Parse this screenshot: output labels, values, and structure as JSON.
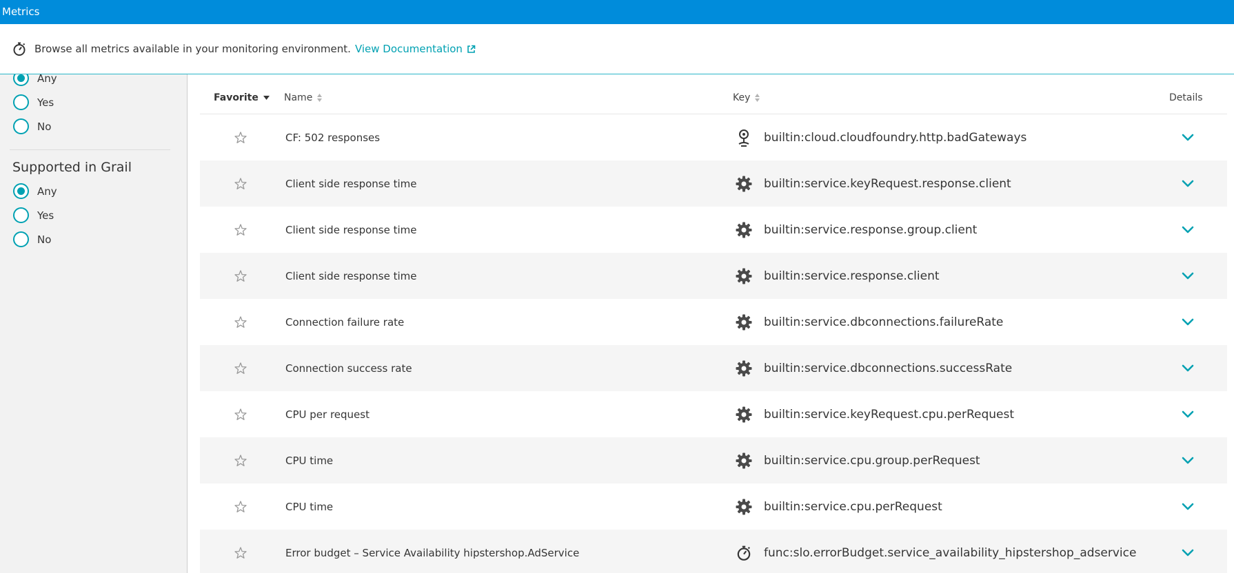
{
  "topbar": {
    "title": "Metrics"
  },
  "info": {
    "text": "Browse all metrics available in your monitoring environment.",
    "link": "View Documentation",
    "icon": "stopwatch-icon"
  },
  "filters": {
    "group1": {
      "options": [
        {
          "label": "Any",
          "selected": true
        },
        {
          "label": "Yes",
          "selected": false
        },
        {
          "label": "No",
          "selected": false
        }
      ]
    },
    "group2": {
      "title": "Supported in Grail",
      "options": [
        {
          "label": "Any",
          "selected": true
        },
        {
          "label": "Yes",
          "selected": false
        },
        {
          "label": "No",
          "selected": false
        }
      ]
    }
  },
  "table": {
    "columns": {
      "favorite": "Favorite",
      "name": "Name",
      "key": "Key",
      "details": "Details"
    },
    "rows": [
      {
        "name": "CF: 502 responses",
        "key": "builtin:cloud.cloudfoundry.http.badGateways",
        "icon": "cloudfoundry-icon"
      },
      {
        "name": "Client side response time",
        "key": "builtin:service.keyRequest.response.client",
        "icon": "service-gear-icon"
      },
      {
        "name": "Client side response time",
        "key": "builtin:service.response.group.client",
        "icon": "service-gear-icon"
      },
      {
        "name": "Client side response time",
        "key": "builtin:service.response.client",
        "icon": "service-gear-icon"
      },
      {
        "name": "Connection failure rate",
        "key": "builtin:service.dbconnections.failureRate",
        "icon": "service-gear-icon"
      },
      {
        "name": "Connection success rate",
        "key": "builtin:service.dbconnections.successRate",
        "icon": "service-gear-icon"
      },
      {
        "name": "CPU per request",
        "key": "builtin:service.keyRequest.cpu.perRequest",
        "icon": "service-gear-icon"
      },
      {
        "name": "CPU time",
        "key": "builtin:service.cpu.group.perRequest",
        "icon": "service-gear-icon"
      },
      {
        "name": "CPU time",
        "key": "builtin:service.cpu.perRequest",
        "icon": "service-gear-icon"
      },
      {
        "name": "Error budget – Service Availability hipstershop.AdService",
        "key": "func:slo.errorBudget.service_availability_hipstershop_adservice",
        "icon": "stopwatch-icon"
      }
    ]
  },
  "colors": {
    "accent": "#00a1b2",
    "header": "#008cdb"
  }
}
